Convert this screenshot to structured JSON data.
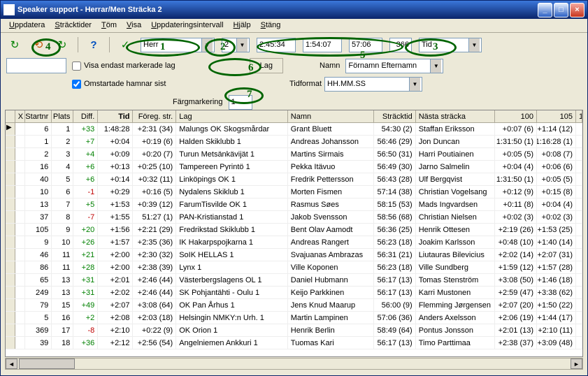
{
  "title": "Speaker support - Herrar/Men Sträcka 2",
  "menu": [
    "Uppdatera",
    "Sträcktider",
    "Töm",
    "Visa",
    "Uppdateringsintervall",
    "Hjälp",
    "Stäng"
  ],
  "combo_class": "Herr",
  "leg_no": "2",
  "time_a": "2:45:34",
  "time_b": "1:54:07",
  "time_c": "57:06",
  "count": "366",
  "sort_combo": "Tid",
  "chk_marked": "Visa endast markerade lag",
  "chk_restart": "Omstartade hamnar sist",
  "btn_lag": "Lag",
  "lbl_namn": "Namn",
  "val_namn": "Förnamn Efternamn",
  "lbl_tidformat": "Tidformat",
  "val_tidformat": "HH.MM.SS",
  "lbl_farg": "Färgmarkering",
  "val_farg": "1",
  "annotations": {
    "1": "1",
    "2": "2",
    "3": "3",
    "4": "4",
    "5": "5",
    "6": "6",
    "7": "7"
  },
  "columns": [
    "X",
    "Startnr",
    "Plats",
    "Diff.",
    "Tid",
    "Föreg. str.",
    "Lag",
    "Namn",
    "Sträcktid",
    "Nästa sträcka",
    "100",
    "105",
    "1"
  ],
  "rows": [
    {
      "start": "6",
      "plats": "1",
      "diff": "+33",
      "tid": "1:48:28",
      "foreg": "+2:31 (34)",
      "lag": "Malungs OK Skogsmårdar",
      "namn": "Grant Bluett",
      "strack": "54:30 (2)",
      "nasta": "Staffan Eriksson",
      "c100": "+0:07 (6)",
      "c105": "+1:14 (12)"
    },
    {
      "start": "1",
      "plats": "2",
      "diff": "+7",
      "tid": "+0:04",
      "foreg": "+0:19 (6)",
      "lag": "Halden Skiklubb 1",
      "namn": "Andreas Johansson",
      "strack": "56:46 (29)",
      "nasta": "Jon Duncan",
      "c100": "1:31:50 (1)",
      "c105": "1:16:28 (1)"
    },
    {
      "start": "2",
      "plats": "3",
      "diff": "+4",
      "tid": "+0:09",
      "foreg": "+0:20 (7)",
      "lag": "Turun Metsänkävijät 1",
      "namn": "Martins Sirmais",
      "strack": "56:50 (31)",
      "nasta": "Harri Poutiainen",
      "c100": "+0:05 (5)",
      "c105": "+0:08 (7)"
    },
    {
      "start": "16",
      "plats": "4",
      "diff": "+6",
      "tid": "+0:13",
      "foreg": "+0:25 (10)",
      "lag": "Tampereen Pyrintö 1",
      "namn": "Pekka Itävuo",
      "strack": "56:49 (30)",
      "nasta": "Jarno Salmelin",
      "c100": "+0:04 (4)",
      "c105": "+0:06 (6)"
    },
    {
      "start": "40",
      "plats": "5",
      "diff": "+6",
      "tid": "+0:14",
      "foreg": "+0:32 (11)",
      "lag": "Linköpings OK 1",
      "namn": "Fredrik Pettersson",
      "strack": "56:43 (28)",
      "nasta": "Ulf Bergqvist",
      "c100": "1:31:50 (1)",
      "c105": "+0:05 (5)"
    },
    {
      "start": "10",
      "plats": "6",
      "diff": "-1",
      "tid": "+0:29",
      "foreg": "+0:16 (5)",
      "lag": "Nydalens Skiklub 1",
      "namn": "Morten Fismen",
      "strack": "57:14 (38)",
      "nasta": "Christian Vogelsang",
      "c100": "+0:12 (9)",
      "c105": "+0:15 (8)"
    },
    {
      "start": "13",
      "plats": "7",
      "diff": "+5",
      "tid": "+1:53",
      "foreg": "+0:39 (12)",
      "lag": "FarumTisvilde OK 1",
      "namn": "Rasmus Søes",
      "strack": "58:15 (53)",
      "nasta": "Mads Ingvardsen",
      "c100": "+0:11 (8)",
      "c105": "+0:04 (4)"
    },
    {
      "start": "37",
      "plats": "8",
      "diff": "-7",
      "tid": "+1:55",
      "foreg": "51:27 (1)",
      "lag": "PAN-Kristianstad 1",
      "namn": "Jakob Svensson",
      "strack": "58:56 (68)",
      "nasta": "Christian Nielsen",
      "c100": "+0:02 (3)",
      "c105": "+0:02 (3)"
    },
    {
      "start": "105",
      "plats": "9",
      "diff": "+20",
      "tid": "+1:56",
      "foreg": "+2:21 (29)",
      "lag": "Fredrikstad Skiklubb 1",
      "namn": "Bent Olav Aamodt",
      "strack": "56:36 (25)",
      "nasta": "Henrik Ottesen",
      "c100": "+2:19 (26)",
      "c105": "+1:53 (25)"
    },
    {
      "start": "9",
      "plats": "10",
      "diff": "+26",
      "tid": "+1:57",
      "foreg": "+2:35 (36)",
      "lag": "IK Hakarpspojkarna 1",
      "namn": "Andreas Rangert",
      "strack": "56:23 (18)",
      "nasta": "Joakim Karlsson",
      "c100": "+0:48 (10)",
      "c105": "+1:40 (14)"
    },
    {
      "start": "46",
      "plats": "11",
      "diff": "+21",
      "tid": "+2:00",
      "foreg": "+2:30 (32)",
      "lag": "SoIK HELLAS 1",
      "namn": "Svajuanas Ambrazas",
      "strack": "56:31 (21)",
      "nasta": "Liutauras Bilevicius",
      "c100": "+2:02 (14)",
      "c105": "+2:07 (31)"
    },
    {
      "start": "86",
      "plats": "11",
      "diff": "+28",
      "tid": "+2:00",
      "foreg": "+2:38 (39)",
      "lag": "Lynx 1",
      "namn": "Ville Koponen",
      "strack": "56:23 (18)",
      "nasta": "Ville Sundberg",
      "c100": "+1:59 (12)",
      "c105": "+1:57 (28)"
    },
    {
      "start": "65",
      "plats": "13",
      "diff": "+31",
      "tid": "+2:01",
      "foreg": "+2:46 (44)",
      "lag": "Västerbergslagens OL 1",
      "namn": "Daniel Hubmann",
      "strack": "56:17 (13)",
      "nasta": "Tomas Stenström",
      "c100": "+3:08 (50)",
      "c105": "+1:46 (18)"
    },
    {
      "start": "249",
      "plats": "13",
      "diff": "+31",
      "tid": "+2:02",
      "foreg": "+2:46 (44)",
      "lag": "SK Pohjantähti - Oulu 1",
      "namn": "Keijo Parkkinen",
      "strack": "56:17 (13)",
      "nasta": "Karri Mustonen",
      "c100": "+2:59 (47)",
      "c105": "+3:38 (62)"
    },
    {
      "start": "79",
      "plats": "15",
      "diff": "+49",
      "tid": "+2:07",
      "foreg": "+3:08 (64)",
      "lag": "OK Pan Århus 1",
      "namn": "Jens Knud Maarup",
      "strack": "56:00 (9)",
      "nasta": "Flemming Jørgensen",
      "c100": "+2:07 (20)",
      "c105": "+1:50 (22)"
    },
    {
      "start": "5",
      "plats": "16",
      "diff": "+2",
      "tid": "+2:08",
      "foreg": "+2:03 (18)",
      "lag": "Helsingin NMKY:n Urh. 1",
      "namn": "Martin Lampinen",
      "strack": "57:06 (36)",
      "nasta": "Anders Axelsson",
      "c100": "+2:06 (19)",
      "c105": "+1:44 (17)"
    },
    {
      "start": "369",
      "plats": "17",
      "diff": "-8",
      "tid": "+2:10",
      "foreg": "+0:22 (9)",
      "lag": "OK Orion 1",
      "namn": "Henrik Berlin",
      "strack": "58:49 (64)",
      "nasta": "Pontus Jonsson",
      "c100": "+2:01 (13)",
      "c105": "+2:10 (11)"
    },
    {
      "start": "39",
      "plats": "18",
      "diff": "+36",
      "tid": "+2:12",
      "foreg": "+2:56 (54)",
      "lag": "Angelniemen Ankkuri 1",
      "namn": "Tuomas Kari",
      "strack": "56:17 (13)",
      "nasta": "Timo Parttimaa",
      "c100": "+2:38 (37)",
      "c105": "+3:09 (48)"
    }
  ]
}
